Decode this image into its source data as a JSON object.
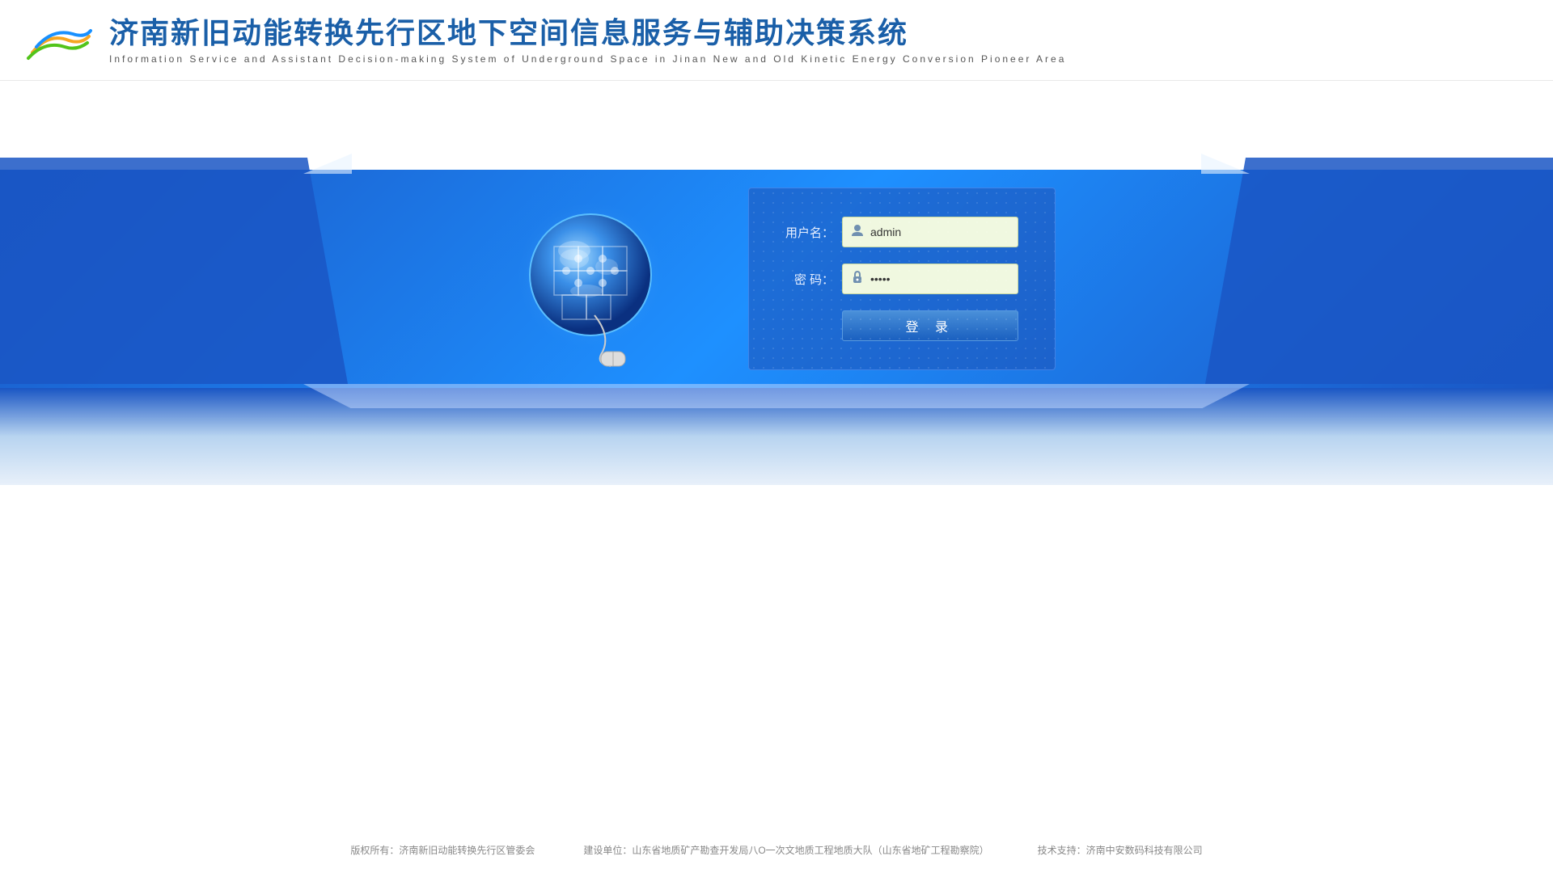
{
  "header": {
    "main_title": "济南新旧动能转换先行区地下空间信息服务与辅助决策系统",
    "sub_title": "Information  Service  and  Assistant  Decision-making  System  of  Underground  Space  in  Jinan  New  and  Old  Kinetic  Energy  Conversion  Pioneer  Area"
  },
  "form": {
    "username_label": "用户名：",
    "password_label": "密  码：",
    "username_value": "admin",
    "password_value": "•••••",
    "login_button": "登    录",
    "username_icon": "👤",
    "password_icon": "🔒"
  },
  "footer": {
    "copyright": "版权所有：济南新旧动能转换先行区管委会",
    "builder": "建设单位：山东省地质矿产勘查开发局八O一次文地质工程地质大队（山东省地矿工程勘察院）",
    "tech_support": "技术支持：济南中安数码科技有限公司"
  }
}
